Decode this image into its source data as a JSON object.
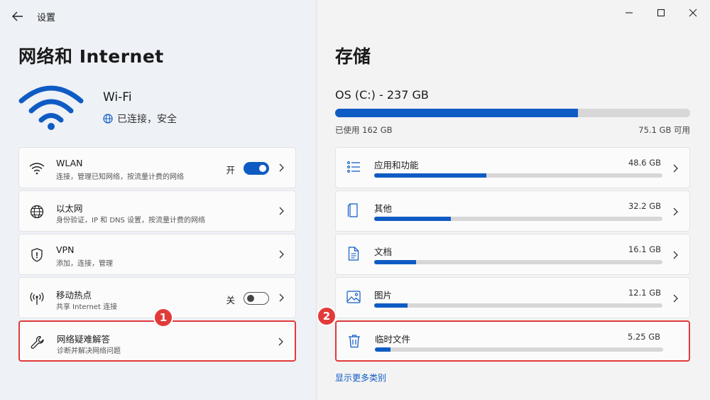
{
  "app": {
    "title": "设置"
  },
  "left": {
    "page_title": "网络和 Internet",
    "wifi": {
      "name": "Wi-Fi",
      "status": "已连接，安全"
    },
    "items": [
      {
        "title": "WLAN",
        "subtitle": "连接，管理已知网络，按流量计费的网络",
        "icon": "wifi-icon",
        "toggle": {
          "label": "开",
          "state": "on"
        }
      },
      {
        "title": "以太网",
        "subtitle": "身份验证，IP 和 DNS 设置，按流量计费的网络",
        "icon": "ethernet-globe-icon"
      },
      {
        "title": "VPN",
        "subtitle": "添加，连接，管理",
        "icon": "shield-icon"
      },
      {
        "title": "移动热点",
        "subtitle": "共享 Internet 连接",
        "icon": "hotspot-icon",
        "toggle": {
          "label": "关",
          "state": "off"
        }
      },
      {
        "title": "网络疑难解答",
        "subtitle": "诊断并解决网络问题",
        "icon": "wrench-icon"
      }
    ],
    "badge": "1"
  },
  "right": {
    "title": "存储",
    "drive": {
      "label": "OS (C:) - 237 GB",
      "used_label": "已使用 162 GB",
      "free_label": "75.1 GB 可用",
      "used_fraction": 0.6835
    },
    "categories": [
      {
        "name": "应用和功能",
        "size": "48.6 GB",
        "icon": "apps-list-icon",
        "fraction": 0.39
      },
      {
        "name": "其他",
        "size": "32.2 GB",
        "icon": "other-file-icon",
        "fraction": 0.265
      },
      {
        "name": "文档",
        "size": "16.1 GB",
        "icon": "document-icon",
        "fraction": 0.145
      },
      {
        "name": "图片",
        "size": "12.1 GB",
        "icon": "picture-icon",
        "fraction": 0.115
      },
      {
        "name": "临时文件",
        "size": "5.25 GB",
        "icon": "trash-icon",
        "fraction": 0.055
      }
    ],
    "more_link": "显示更多类别",
    "badge": "2"
  },
  "colors": {
    "accent": "#0f5bc4",
    "highlight": "#e23a3a"
  }
}
